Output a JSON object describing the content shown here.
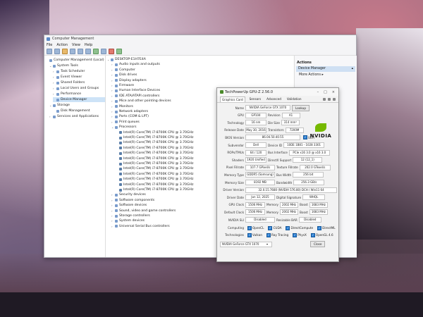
{
  "window": {
    "title": "Computer Management",
    "menu": [
      "File",
      "Action",
      "View",
      "Help"
    ]
  },
  "left_tree": [
    {
      "label": "Computer Management (Local)",
      "indent": 0,
      "exp": "",
      "sel": false
    },
    {
      "label": "System Tools",
      "indent": 1,
      "exp": "v",
      "sel": false
    },
    {
      "label": "Task Scheduler",
      "indent": 2,
      "exp": ">",
      "sel": false
    },
    {
      "label": "Event Viewer",
      "indent": 2,
      "exp": ">",
      "sel": false
    },
    {
      "label": "Shared Folders",
      "indent": 2,
      "exp": ">",
      "sel": false
    },
    {
      "label": "Local Users and Groups",
      "indent": 2,
      "exp": ">",
      "sel": false
    },
    {
      "label": "Performance",
      "indent": 2,
      "exp": ">",
      "sel": false
    },
    {
      "label": "Device Manager",
      "indent": 2,
      "exp": "",
      "sel": true
    },
    {
      "label": "Storage",
      "indent": 1,
      "exp": "v",
      "sel": false
    },
    {
      "label": "Disk Management",
      "indent": 2,
      "exp": "",
      "sel": false
    },
    {
      "label": "Services and Applications",
      "indent": 1,
      "exp": ">",
      "sel": false
    }
  ],
  "device_tree": {
    "root": "DESKTOP-E1H7E4A",
    "categories_top": [
      "Audio inputs and outputs",
      "Computer",
      "Disk drives",
      "Display adapters",
      "Firmware",
      "Human Interface Devices",
      "IDE ATA/ATAPI controllers",
      "Mice and other pointing devices",
      "Monitors",
      "Network adapters",
      "Ports (COM & LPT)",
      "Print queues",
      "Processors"
    ],
    "processors": [
      "Intel(R) Core(TM) i7-8700K CPU @ 3.70GHz",
      "Intel(R) Core(TM) i7-8700K CPU @ 3.70GHz",
      "Intel(R) Core(TM) i7-8700K CPU @ 3.70GHz",
      "Intel(R) Core(TM) i7-8700K CPU @ 3.70GHz",
      "Intel(R) Core(TM) i7-8700K CPU @ 3.70GHz",
      "Intel(R) Core(TM) i7-8700K CPU @ 3.70GHz",
      "Intel(R) Core(TM) i7-8700K CPU @ 3.70GHz",
      "Intel(R) Core(TM) i7-8700K CPU @ 3.70GHz",
      "Intel(R) Core(TM) i7-8700K CPU @ 3.70GHz",
      "Intel(R) Core(TM) i7-8700K CPU @ 3.70GHz",
      "Intel(R) Core(TM) i7-8700K CPU @ 3.70GHz",
      "Intel(R) Core(TM) i7-8700K CPU @ 3.70GHz"
    ],
    "categories_bottom": [
      "Security devices",
      "Software components",
      "Software devices",
      "Sound, video and game controllers",
      "Storage controllers",
      "System devices",
      "Universal Serial Bus controllers"
    ]
  },
  "actions": {
    "header": "Actions",
    "selected": "Device Manager",
    "more": "More Actions"
  },
  "gpuz": {
    "title": "TechPowerUp GPU-Z 2.56.0",
    "tabs": [
      "Graphics Card",
      "Sensors",
      "Advanced",
      "Validation"
    ],
    "name_label": "Name",
    "name": "NVIDIA GeForce GTX 1070",
    "lookup": "Lookup",
    "gpu_label": "GPU",
    "gpu": "GP104",
    "revision_label": "Revision",
    "revision": "A1",
    "tech_label": "Technology",
    "tech": "16 nm",
    "diesize_label": "Die Size",
    "diesize": "314 mm²",
    "release_label": "Release Date",
    "release": "May 30, 2016",
    "transistors_label": "Transistors",
    "transistors": "7200M",
    "bios_label": "BIOS Version",
    "bios": "86.04.50.40.55",
    "uefi": "UEFI",
    "subvendor_label": "Subvendor",
    "subvendor": "Dell",
    "deviceid_label": "Device ID",
    "deviceid": "10DE 1B81 - 1028 3301",
    "rops_label": "ROPs/TMUs",
    "rops": "64 / 120",
    "bus_label": "Bus Interface",
    "bus": "PCIe x16 3.0 @ x16 3.0",
    "shaders_label": "Shaders",
    "shaders": "1920 Unified",
    "dx_label": "DirectX Support",
    "dx": "12 (12_1)",
    "pixel_label": "Pixel Fillrate",
    "pixel": "107.7 GPixel/s",
    "texture_label": "Texture Fillrate",
    "texture": "202.0 GTexel/s",
    "memtype_label": "Memory Type",
    "memtype": "GDDR5 (Samsung)",
    "buswidth_label": "Bus Width",
    "buswidth": "256 bit",
    "memsize_label": "Memory Size",
    "memsize": "8192 MB",
    "bandwidth_label": "Bandwidth",
    "bandwidth": "256.3 GB/s",
    "driver_label": "Driver Version",
    "driver": "32.0.15.7680 (NVIDIA 576.80) DCH / Win11 64",
    "driverdate_label": "Driver Date",
    "driverdate": "Jun 12, 2025",
    "digsig_label": "Digital Signature",
    "digsig": "WHQL",
    "gpuclock_label": "GPU Clock",
    "gpuclock": "1506 MHz",
    "memory_label": "Memory",
    "memclock": "2002 MHz",
    "boost_label": "Boost",
    "boost": "1683 MHz",
    "defclock_label": "Default Clock",
    "defclock": "1506 MHz",
    "defmem": "2002 MHz",
    "defboost": "1683 MHz",
    "sli_label": "NVIDIA SLI",
    "sli": "Disabled",
    "rbar_label": "Resizable BAR",
    "rbar": "Disabled",
    "computing_label": "Computing",
    "computing": [
      "OpenCL",
      "CUDA",
      "DirectCompute",
      "DirectML"
    ],
    "tech2_label": "Technologies",
    "technologies": [
      "Vulkan",
      "Ray Tracing",
      "PhysX",
      "OpenGL 4.6"
    ],
    "selected_gpu": "NVIDIA GeForce GTX 1070",
    "close": "Close",
    "logo_text": "NVIDIA"
  }
}
